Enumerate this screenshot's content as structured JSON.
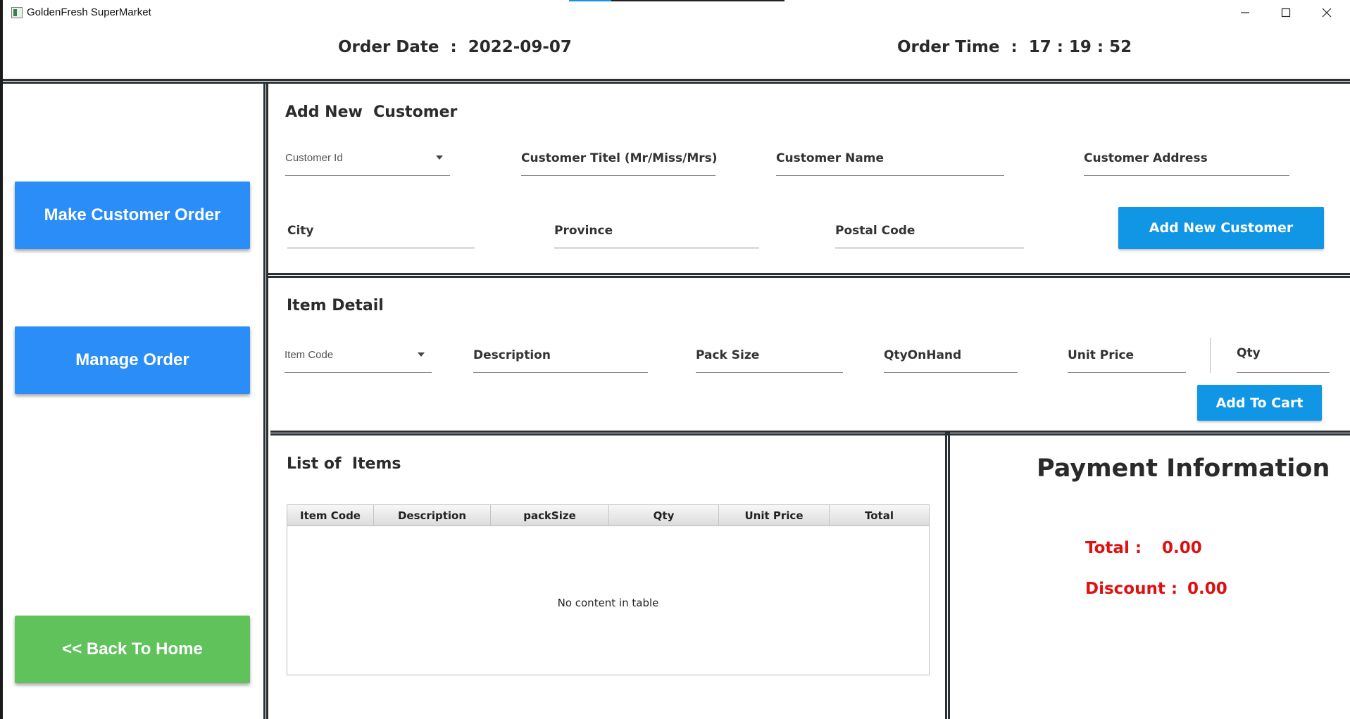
{
  "window": {
    "title": "GoldenFresh SuperMarket",
    "icon": "app-icon",
    "accent_color": "#1196e6",
    "controls": [
      "minimize-icon",
      "maximize-icon",
      "close-icon"
    ]
  },
  "header": {
    "order_date_label": "Order Date  :  ",
    "order_date_value": "2022-09-07",
    "order_time_label": "Order Time  :  ",
    "order_time_value": "17 : 19 : 52"
  },
  "sidebar": {
    "make_order": "Make Customer Order",
    "manage_order": "Manage Order",
    "back_home": "<< Back To Home",
    "blue_color": "#2b8df7",
    "green_color": "#5fc25b"
  },
  "customer": {
    "title": "Add New  Customer",
    "customer_id": "Customer Id",
    "title_field": "Customer Titel (Mr/Miss/Mrs)",
    "name": "Customer Name",
    "address": "Customer Address",
    "city": "City",
    "province": "Province",
    "postal_code": "Postal Code",
    "add_button": "Add New Customer"
  },
  "item": {
    "title": "Item Detail",
    "item_code": "Item Code",
    "description": "Description",
    "pack_size": "Pack Size",
    "qty_on_hand": "QtyOnHand",
    "unit_price": "Unit Price",
    "qty": "Qty",
    "add_to_cart": "Add To Cart"
  },
  "items_list": {
    "title": "List of  Items",
    "columns": [
      "Item Code",
      "Description",
      "packSize",
      "Qty",
      "Unit Price",
      "Total"
    ],
    "empty_text": "No content in table"
  },
  "payment": {
    "title": "Payment Information",
    "total_label": "Total :",
    "total_value": "0.00",
    "discount_label": "Discount :",
    "discount_value": "0.00",
    "value_color": "#e01010"
  }
}
